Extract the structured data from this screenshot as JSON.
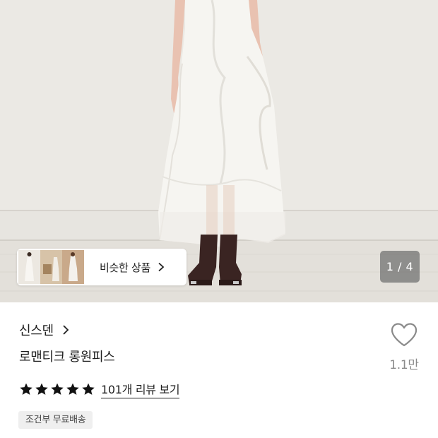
{
  "gallery": {
    "similar_label": "비슷한 상품",
    "page_indicator": "1 / 4",
    "chevron_icon": "chevron-right-icon"
  },
  "product": {
    "brand": "신스덴",
    "name": "로맨티크 롱원피스",
    "rating_stars": 5,
    "review_link": "101개 리뷰 보기",
    "shipping_badge": "조건부 무료배송",
    "like_count": "1.1만",
    "like_icon": "heart-outline-icon"
  },
  "colors": {
    "star": "#111111",
    "heart": "#8a8a8a",
    "badge_bg": "#efefef"
  }
}
